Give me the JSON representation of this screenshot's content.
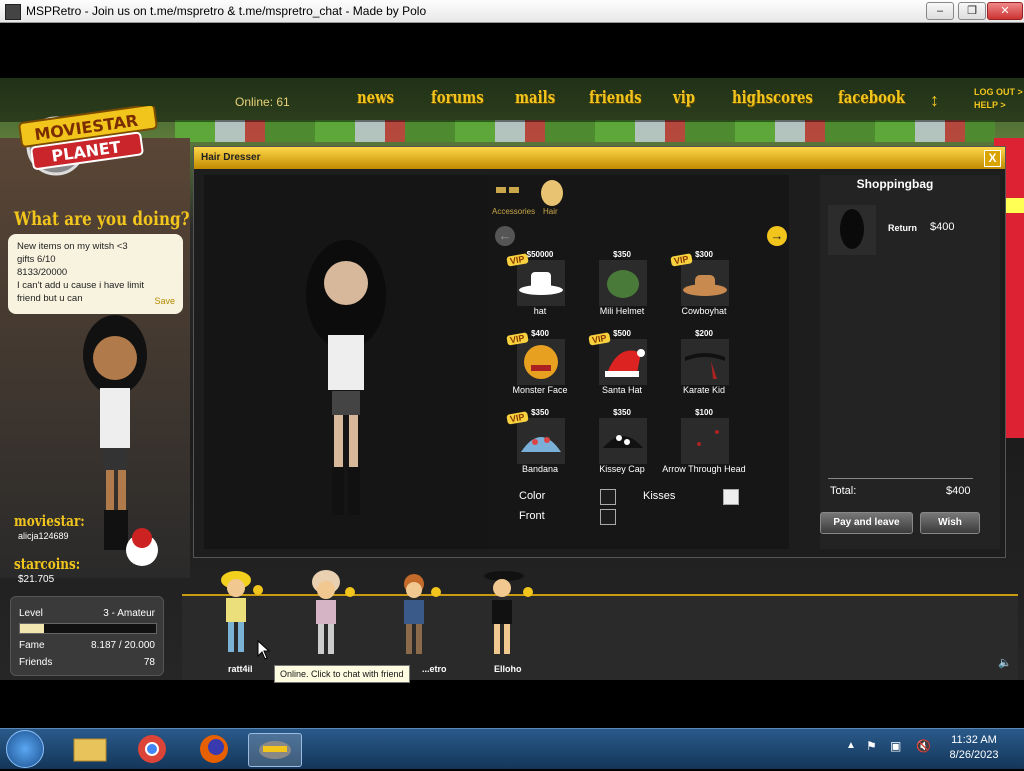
{
  "window": {
    "title": "MSPRetro - Join us on t.me/mspretro & t.me/mspretro_chat - Made by Polo",
    "min_label": "‒",
    "max_label": "❐",
    "close_label": "✕"
  },
  "nav": {
    "online": "Online: 61",
    "items": [
      "news",
      "forums",
      "mails",
      "friends",
      "vip",
      "highscores",
      "facebook"
    ],
    "sort_icon": "↕",
    "logout": "LOG OUT >",
    "help": "HELP >"
  },
  "logo": {
    "line1": "MOVIESTAR",
    "line2": "PLANET"
  },
  "profile": {
    "what_doing": "What are you doing?",
    "status_lines": [
      "New items on my witsh <3",
      "gifts 6/10",
      "8133/20000",
      "I can't add u cause i have limit friend but u can"
    ],
    "save_label": "Save",
    "moviestar_label": "moviestar:",
    "username": "alicja124689",
    "starcoins_label": "starcoins:",
    "starcoins": "$21.705",
    "level_label": "Level",
    "level_value": "3 - Amateur",
    "level_progress": 0.18,
    "fame_label": "Fame",
    "fame_value": "8.187 / 20.000",
    "friends_label": "Friends",
    "friends_value": "78"
  },
  "hairdresser": {
    "title": "Hair Dresser",
    "close": "X",
    "categories": [
      "Accessories",
      "Hair"
    ],
    "items": [
      {
        "price": "$50000",
        "name": "hat",
        "vip": true
      },
      {
        "price": "$350",
        "name": "Mili Helmet",
        "vip": false
      },
      {
        "price": "$300",
        "name": "Cowboyhat",
        "vip": true
      },
      {
        "price": "$400",
        "name": "Monster Face",
        "vip": true
      },
      {
        "price": "$500",
        "name": "Santa Hat",
        "vip": true
      },
      {
        "price": "$200",
        "name": "Karate Kid",
        "vip": false
      },
      {
        "price": "$350",
        "name": "Bandana",
        "vip": true
      },
      {
        "price": "$350",
        "name": "Kissey Cap",
        "vip": false
      },
      {
        "price": "$100",
        "name": "Arrow Through Head",
        "vip": false
      }
    ],
    "vip_label": "VIP",
    "color_label": "Color",
    "front_label": "Front",
    "kisses_label": "Kisses",
    "bag": {
      "title": "Shoppingbag",
      "return_label": "Return",
      "return_price": "$400",
      "total_label": "Total:",
      "total_value": "$400",
      "pay_label": "Pay and leave",
      "wish_label": "Wish"
    }
  },
  "friends_bar": {
    "names": [
      "ratt4il",
      "",
      "...etro",
      "Elloho"
    ],
    "tooltip": "Online. Click to chat with friend"
  },
  "taskbar": {
    "time": "11:32 AM",
    "date": "8/26/2023"
  },
  "colors": {
    "accent": "#f2c51d",
    "panel": "#1d1d1d",
    "header": "#e0a800"
  }
}
